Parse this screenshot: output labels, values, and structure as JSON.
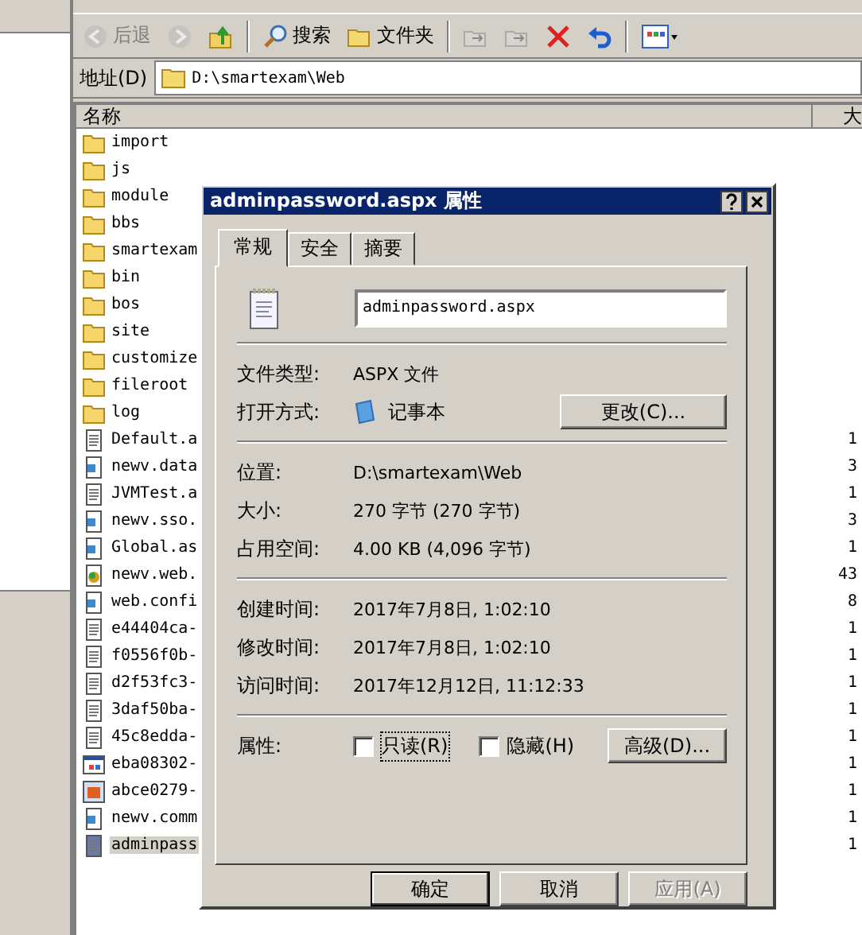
{
  "toolbar": [
    {
      "kind": "back",
      "label": "后退",
      "disabled": true
    },
    {
      "kind": "forward",
      "disabled": true
    },
    {
      "kind": "up",
      "disabled": false
    },
    {
      "kind": "search",
      "label": "搜索",
      "disabled": false
    },
    {
      "kind": "folders",
      "label": "文件夹",
      "disabled": false
    },
    {
      "kind": "move",
      "disabled": true
    },
    {
      "kind": "copy",
      "disabled": true
    },
    {
      "kind": "delete",
      "disabled": false
    },
    {
      "kind": "undo",
      "disabled": false
    },
    {
      "kind": "views",
      "disabled": false
    }
  ],
  "address": {
    "label": "地址(D)",
    "value": "D:\\smartexam\\Web"
  },
  "list": {
    "columns": [
      "名称",
      "大"
    ],
    "rows": [
      {
        "name": "import",
        "kind": "folder",
        "selected": false
      },
      {
        "name": "js",
        "kind": "folder",
        "selected": false
      },
      {
        "name": "module",
        "kind": "folder",
        "selected": false
      },
      {
        "name": "bbs",
        "kind": "folder",
        "selected": false
      },
      {
        "name": "smartexam",
        "kind": "folder",
        "selected": false
      },
      {
        "name": "bin",
        "kind": "folder",
        "selected": false
      },
      {
        "name": "bos",
        "kind": "folder",
        "selected": false
      },
      {
        "name": "site",
        "kind": "folder",
        "selected": false
      },
      {
        "name": "customize",
        "kind": "folder",
        "selected": false
      },
      {
        "name": "fileroot",
        "kind": "folder",
        "selected": false
      },
      {
        "name": "log",
        "kind": "folder",
        "selected": false
      },
      {
        "name": "Default.a",
        "kind": "text",
        "size": "1",
        "selected": false
      },
      {
        "name": "newv.data",
        "kind": "script",
        "size": "3",
        "selected": false
      },
      {
        "name": "JVMTest.a",
        "kind": "text",
        "size": "1",
        "selected": false
      },
      {
        "name": "newv.sso.",
        "kind": "script",
        "size": "3",
        "selected": false
      },
      {
        "name": "Global.as",
        "kind": "script",
        "size": "1",
        "selected": false
      },
      {
        "name": "newv.web.",
        "kind": "web",
        "size": "43",
        "selected": false
      },
      {
        "name": "web.confi",
        "kind": "script",
        "size": "8",
        "selected": false
      },
      {
        "name": "e44404ca-",
        "kind": "text",
        "size": "1",
        "selected": false
      },
      {
        "name": "f0556f0b-",
        "kind": "text",
        "size": "1",
        "selected": false
      },
      {
        "name": "d2f53fc3-",
        "kind": "text",
        "size": "1",
        "selected": false
      },
      {
        "name": "3daf50ba-",
        "kind": "text",
        "size": "1",
        "selected": false
      },
      {
        "name": "45c8edda-",
        "kind": "text",
        "size": "1",
        "selected": false
      },
      {
        "name": "eba08302-",
        "kind": "app",
        "size": "1",
        "selected": false
      },
      {
        "name": "abce0279-",
        "kind": "image",
        "size": "1",
        "selected": false
      },
      {
        "name": "newv.comm",
        "kind": "script",
        "size": "1",
        "selected": false
      },
      {
        "name": "adminpass",
        "kind": "text",
        "size": "1",
        "selected": true
      }
    ]
  },
  "dialog": {
    "title": "adminpassword.aspx 属性",
    "tabs": [
      {
        "label": "常规",
        "selected": true
      },
      {
        "label": "安全",
        "selected": false
      },
      {
        "label": "摘要",
        "selected": false
      }
    ],
    "filename": "adminpassword.aspx",
    "file_type": {
      "label": "文件类型:",
      "value": "ASPX 文件"
    },
    "opens_with": {
      "label": "打开方式:",
      "value": "记事本",
      "button": "更改(C)..."
    },
    "location": [
      {
        "label": "位置:",
        "value": "D:\\smartexam\\Web"
      },
      {
        "label": "大小:",
        "value": "270 字节 (270 字节)"
      },
      {
        "label": "占用空间:",
        "value": "4.00 KB (4,096 字节)"
      }
    ],
    "times": [
      {
        "label": "创建时间:",
        "value": "2017年7月8日, 1:02:10"
      },
      {
        "label": "修改时间:",
        "value": "2017年7月8日, 1:02:10"
      },
      {
        "label": "访问时间:",
        "value": "2017年12月12日, 11:12:33"
      }
    ],
    "attributes": {
      "label": "属性:",
      "checks": [
        {
          "label": "只读(R)",
          "checked": false,
          "focused": true
        },
        {
          "label": "隐藏(H)",
          "checked": false,
          "focused": false
        }
      ],
      "button": "高级(D)..."
    },
    "buttons": [
      {
        "label": "确定",
        "disabled": false,
        "default": true
      },
      {
        "label": "取消",
        "disabled": false,
        "default": false
      },
      {
        "label": "应用(A)",
        "disabled": true,
        "default": false
      }
    ]
  }
}
